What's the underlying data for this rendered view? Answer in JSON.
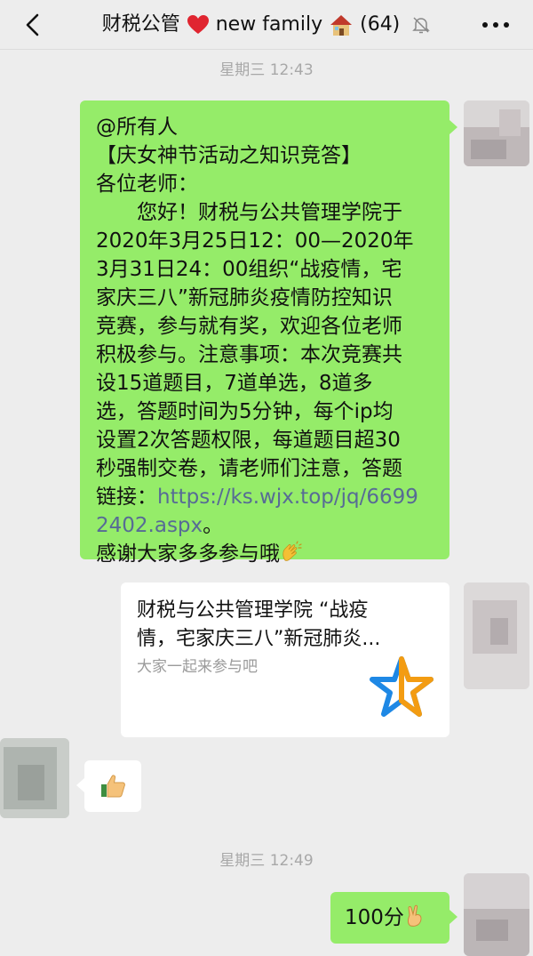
{
  "nav": {
    "back_icon": "chevron-left-icon",
    "title": "财税公管",
    "title_suffix": "new family",
    "count": "(64)",
    "mute_icon": "bell-muted-icon",
    "more_icon": "more-dots-icon"
  },
  "timestamps": [
    "星期三 12:43",
    "星期三 12:49"
  ],
  "message1": {
    "lines": [
      "@所有人",
      "【庆女神节活动之知识竞答】",
      "各位老师：",
      "　　您好！财税与公共管理学院于",
      "2020年3月25日12：00—2020年",
      "3月31日24：00组织“战疫情，宅",
      "家庆三八”新冠肺炎疫情防控知识",
      "竞赛，参与就有奖，欢迎各位老师",
      "积极参与。注意事项：本次竞赛共",
      "设15道题目，7道单选，8道多",
      "选，答题时间为5分钟，每个ip均",
      "设置2次答题权限，每道题目超30",
      "秒强制交卷，请老师们注意，答题"
    ],
    "link_prefix": "链接：",
    "link_part1": "https://ks.wjx.top/jq/6699",
    "link_part2": "2402.aspx",
    "link_suffix": "。",
    "closing": "感谢大家多多参与哦"
  },
  "card": {
    "title_line1": "财税与公共管理学院 “战疫",
    "title_line2": "情，宅家庆三八”新冠肺炎...",
    "description": "大家一起来参与吧",
    "logo_icon": "star-logo-icon"
  },
  "reply_thumbs": "thumbs-up-icon",
  "message2": {
    "text": "100分",
    "emoji": "victory-hand-icon"
  }
}
